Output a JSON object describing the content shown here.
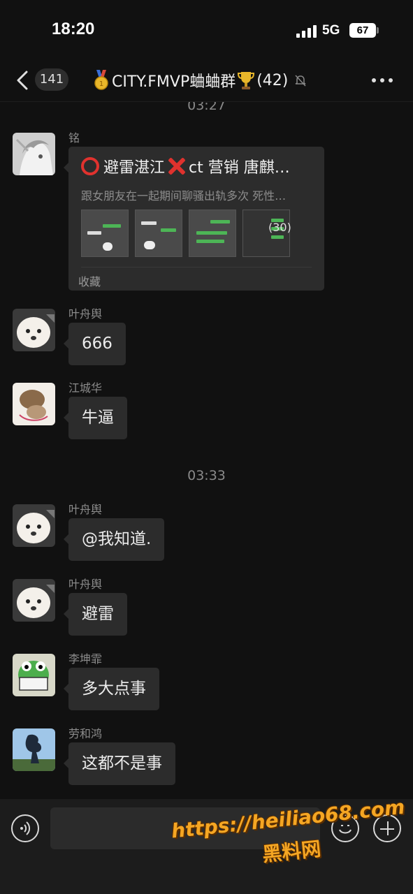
{
  "status_bar": {
    "time": "18:20",
    "network": "5G",
    "battery": "67"
  },
  "nav": {
    "unread_count": "141",
    "title": "CITY.FMVP蛐蛐群",
    "member_count": "(42)",
    "back_icon": "chevron-left-icon",
    "more_icon": "more-dots-icon",
    "mute_icon": "bell-off-icon"
  },
  "chat": {
    "top_timestamp": "03:27",
    "favorite_message": {
      "sender": "铭",
      "title_part1": "避雷湛江",
      "title_part2": "ct 营销 唐麒…",
      "subtitle": "跟女朋友在一起期间聊骚出轨多次 死性…",
      "image_count": "(30)",
      "source": "收藏"
    },
    "messages_a": [
      {
        "sender": "叶舟舆",
        "text": "666"
      },
      {
        "sender": "江城华",
        "text": "牛逼"
      }
    ],
    "mid_timestamp": "03:33",
    "messages_b": [
      {
        "sender": "叶舟舆",
        "text": "@我知道."
      },
      {
        "sender": "叶舟舆",
        "text": "避雷"
      },
      {
        "sender": "李坤霏",
        "text": "多大点事"
      },
      {
        "sender": "劳和鸿",
        "text": "这都不是事"
      }
    ]
  },
  "input_bar": {
    "placeholder": "",
    "voice_icon": "voice-icon",
    "emoji_icon": "emoji-icon",
    "plus_icon": "plus-icon"
  },
  "watermark": {
    "url": "https://heiliao68.com",
    "name": "黑料网"
  },
  "colors": {
    "background": "#111111",
    "bubble": "#2c2c2c",
    "accent_red": "#e0322e",
    "watermark": "#f5a623"
  }
}
